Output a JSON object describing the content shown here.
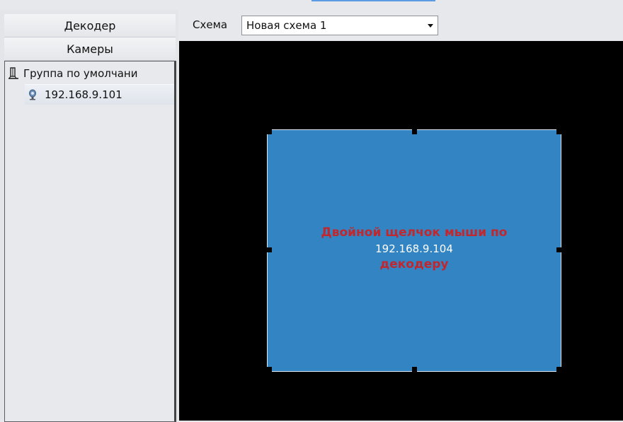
{
  "left_panel": {
    "tabs": [
      {
        "label": "Декодер"
      },
      {
        "label": "Камеры"
      }
    ],
    "tree": {
      "group": {
        "label": "Группа по умолчани",
        "icon": "camera-group-icon"
      },
      "items": [
        {
          "label": "192.168.9.101",
          "icon": "ip-camera-icon"
        }
      ]
    }
  },
  "toolbar": {
    "scheme_label": "Схема",
    "scheme_value": "Новая схема 1"
  },
  "decoder": {
    "line1": "Двойной щелчок мыши по",
    "ip": "192.168.9.104",
    "line3": "декодеру",
    "fill_color": "#3384c3",
    "text_color": "#c1272d"
  }
}
